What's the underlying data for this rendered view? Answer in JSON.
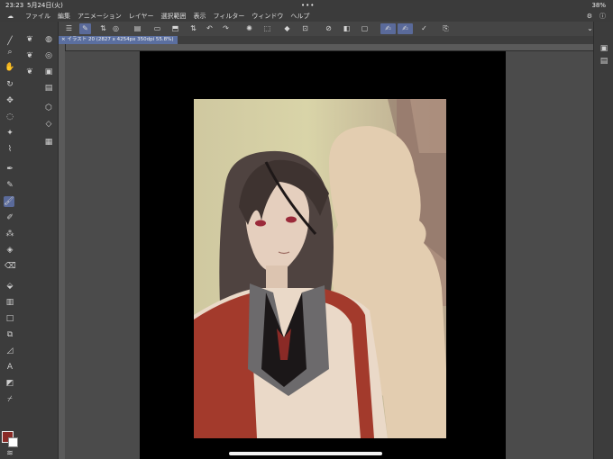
{
  "status_bar": {
    "time": "23:23",
    "date": "5月24日(火)",
    "dots": "•••",
    "battery": "38%"
  },
  "menu": {
    "app_icon": "clip-studio-icon",
    "items": [
      "ファイル",
      "編集",
      "アニメーション",
      "レイヤー",
      "選択範囲",
      "表示",
      "フィルター",
      "ウィンドウ",
      "ヘルプ"
    ]
  },
  "document_tab": {
    "label": "× イラスト 20 (2827 x 4254px 350dpi 55.8%)"
  },
  "colors": {
    "main": "#8a2a26",
    "sub": "#ffffff",
    "accent": "#5a6a9a",
    "canvas_bg": "#000000"
  },
  "tools": {
    "left": [
      "pen-tool-icon",
      "zoom-icon",
      "hand-icon",
      "rotate-icon",
      "move-icon",
      "lasso-icon",
      "magic-wand-icon",
      "eyedropper-icon",
      "pen-icon",
      "pencil-icon",
      "brush-icon",
      "airbrush-icon",
      "decoration-icon",
      "blend-icon",
      "eraser-icon",
      "fill-icon",
      "gradient-icon",
      "figure-icon",
      "frame-icon",
      "ruler-icon",
      "text-icon",
      "balloon-icon",
      "correct-line-icon"
    ],
    "sub": [
      "sub-tool-1-icon",
      "sub-tool-2-icon",
      "sub-tool-3-icon"
    ]
  }
}
